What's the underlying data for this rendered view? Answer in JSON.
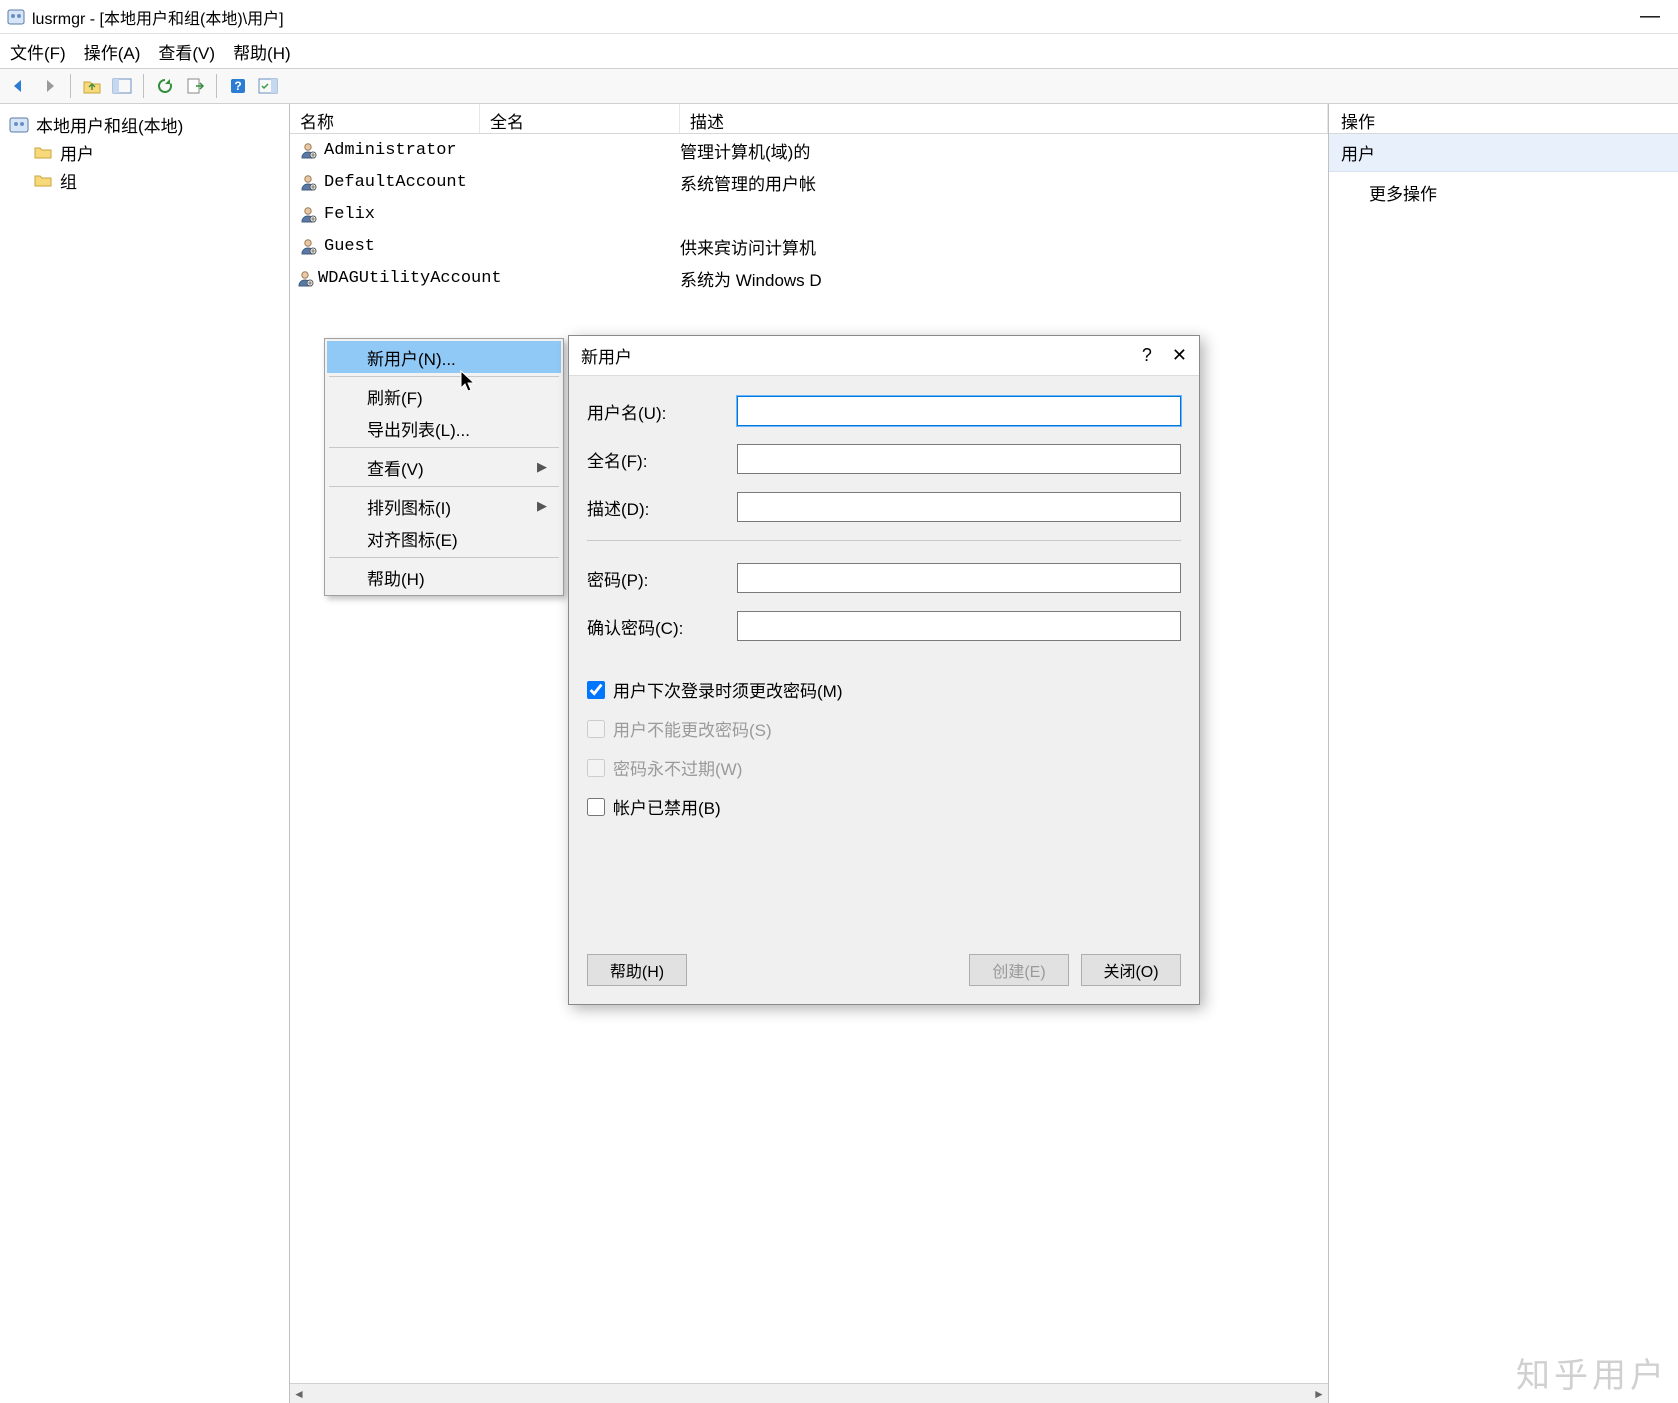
{
  "window": {
    "title": "lusrmgr - [本地用户和组(本地)\\用户]"
  },
  "menubar": {
    "file": "文件(F)",
    "action": "操作(A)",
    "view": "查看(V)",
    "help": "帮助(H)"
  },
  "tree": {
    "root": "本地用户和组(本地)",
    "users": "用户",
    "groups": "组"
  },
  "list": {
    "headers": {
      "name": "名称",
      "fullname": "全名",
      "desc": "描述"
    },
    "rows": [
      {
        "name": "Administrator",
        "full": "",
        "desc": "管理计算机(域)的"
      },
      {
        "name": "DefaultAccount",
        "full": "",
        "desc": "系统管理的用户帐"
      },
      {
        "name": "Felix",
        "full": "",
        "desc": ""
      },
      {
        "name": "Guest",
        "full": "",
        "desc": "供来宾访问计算机"
      },
      {
        "name": "WDAGUtilityAccount",
        "full": "",
        "desc": "系统为 Windows D"
      }
    ]
  },
  "actions": {
    "header": "操作",
    "section": "用户",
    "more": "更多操作"
  },
  "context_menu": {
    "new_user": "新用户(N)...",
    "refresh": "刷新(F)",
    "export": "导出列表(L)...",
    "view": "查看(V)",
    "arrange": "排列图标(I)",
    "align": "对齐图标(E)",
    "help": "帮助(H)"
  },
  "dialog": {
    "title": "新用户",
    "username_label": "用户名(U):",
    "fullname_label": "全名(F):",
    "desc_label": "描述(D):",
    "password_label": "密码(P):",
    "confirm_label": "确认密码(C):",
    "chk_mustchange": "用户下次登录时须更改密码(M)",
    "chk_cannot": "用户不能更改密码(S)",
    "chk_never": "密码永不过期(W)",
    "chk_disabled": "帐户已禁用(B)",
    "btn_help": "帮助(H)",
    "btn_create": "创建(E)",
    "btn_close": "关闭(O)",
    "username_value": "",
    "fullname_value": "",
    "desc_value": "",
    "password_value": "",
    "confirm_value": ""
  },
  "watermark": "知乎用户"
}
